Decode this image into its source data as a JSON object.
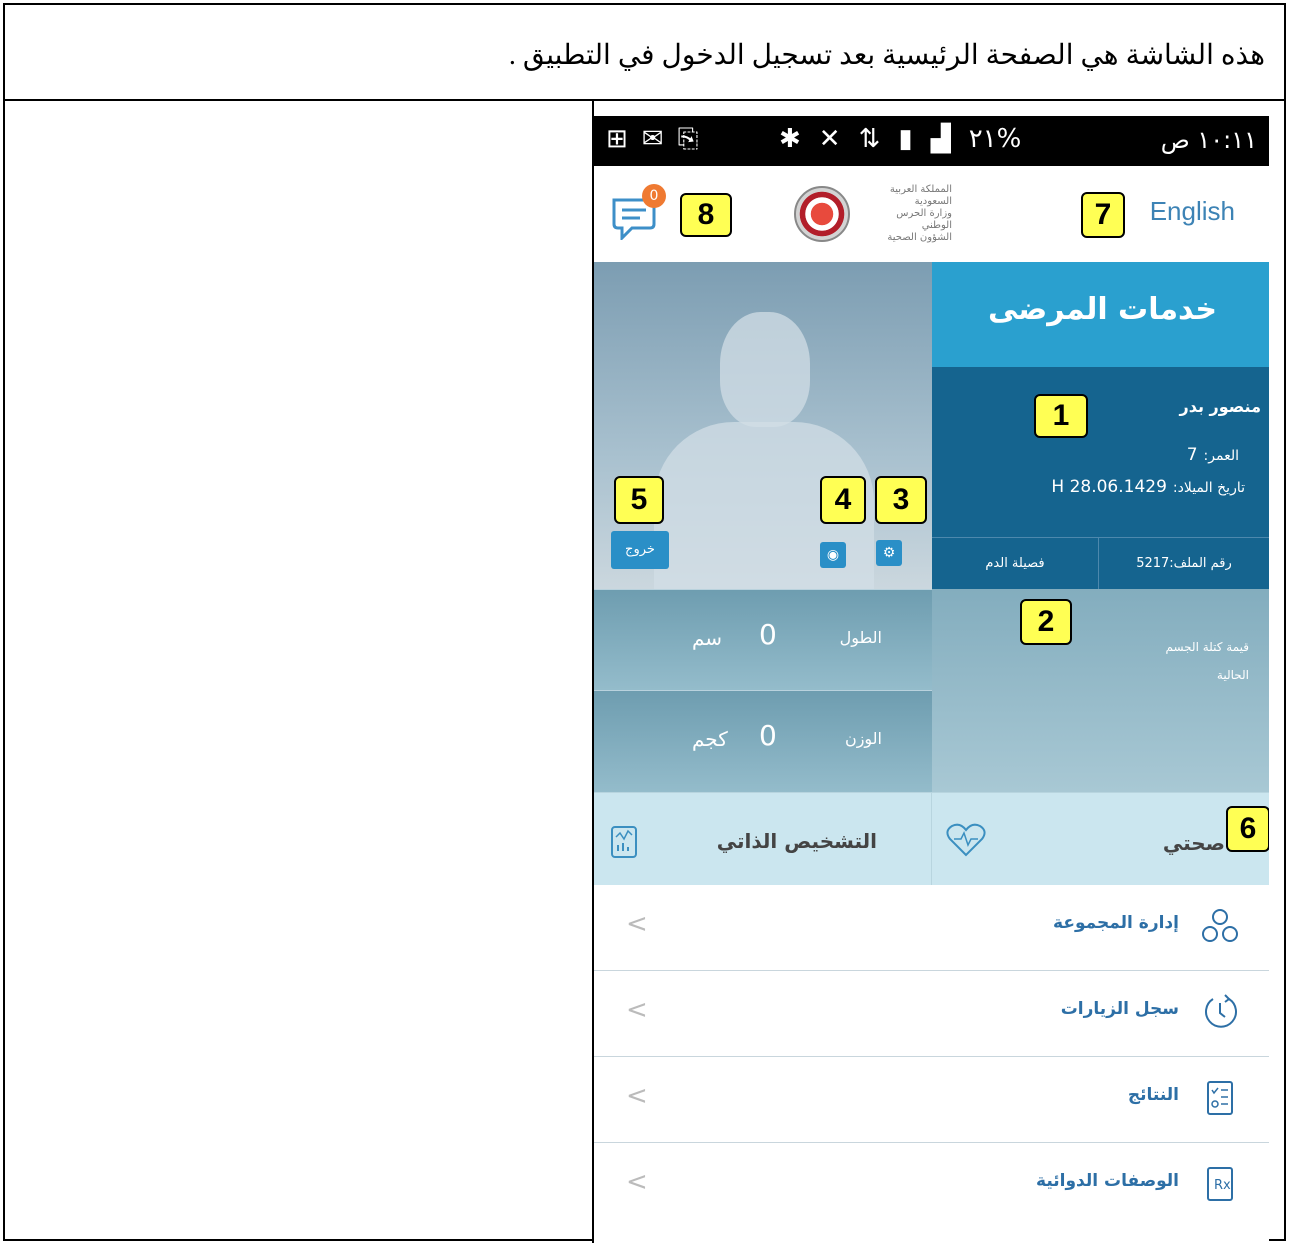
{
  "caption": "هذه الشاشة هي الصفحة الرئيسية بعد تسجيل الدخول في التطبيق .",
  "status_bar": {
    "time": "١٠:١١ ص",
    "battery": "٢١%"
  },
  "header": {
    "language_link": "English",
    "notification_count": "0",
    "logo_lines": [
      "المملكة العربية",
      "السعودية",
      "وزارة الحرس",
      "الوطني",
      "الشؤون الصحية"
    ]
  },
  "services": {
    "title": "خدمات المرضى"
  },
  "patient": {
    "name": "منصور بدر",
    "age_label": "العمر:",
    "age_value": "7",
    "dob_label": "تاريخ الميلاد:",
    "dob_value": "28.06.1429 H",
    "file_label": "رقم الملف:5217",
    "blood_label": "فصيلة الدم"
  },
  "profile": {
    "logout_label": "خروج"
  },
  "stats": [
    {
      "label": "الطول",
      "value": "0",
      "unit": "سم"
    },
    {
      "label": "الوزن",
      "value": "0",
      "unit": "كجم"
    }
  ],
  "bmi": {
    "label_line1": "قيمة كتلة الجسم",
    "label_line2": "الحالية"
  },
  "tiles": {
    "self_diagnosis": "التشخيص الذاتي",
    "my_health": "صحتي"
  },
  "menu": [
    {
      "label": "إدارة المجموعة",
      "icon": "group-icon"
    },
    {
      "label": "سجل الزيارات",
      "icon": "history-icon"
    },
    {
      "label": "النتائج",
      "icon": "results-icon"
    },
    {
      "label": "الوصفات الدوائية",
      "icon": "prescription-icon"
    }
  ],
  "annotations": [
    "1",
    "2",
    "3",
    "4",
    "5",
    "6",
    "7",
    "8"
  ]
}
